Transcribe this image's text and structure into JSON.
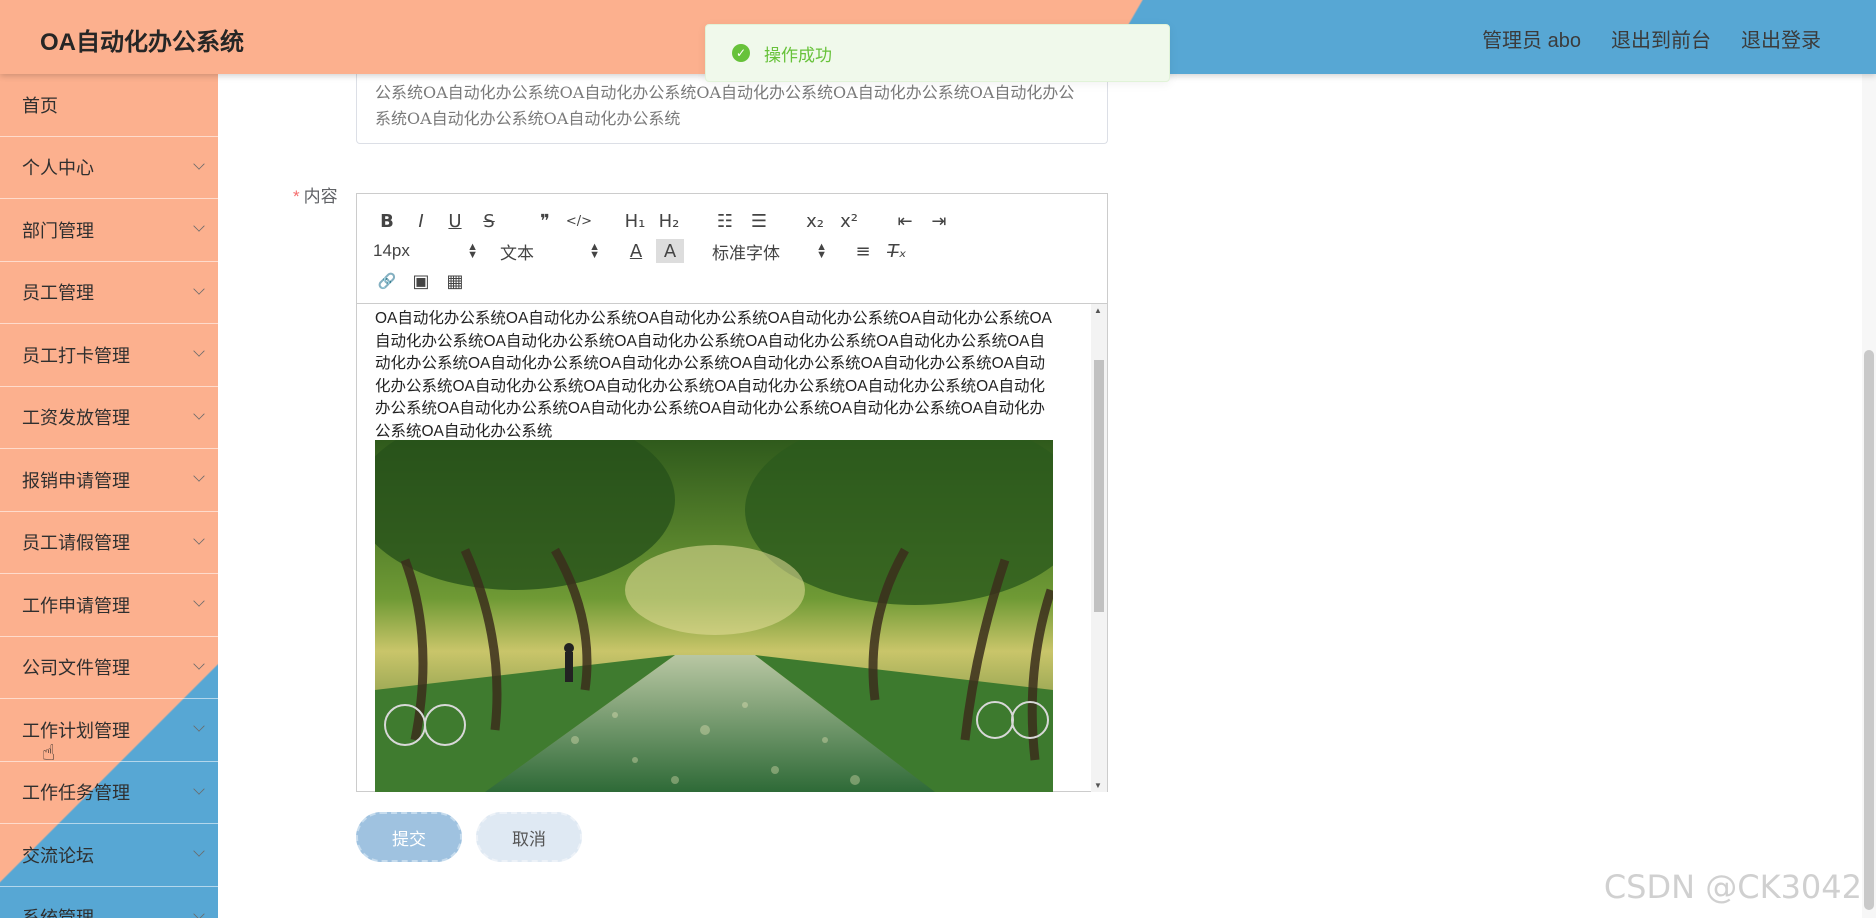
{
  "header": {
    "title": "OA自动化办公系统",
    "user": "管理员 abo",
    "to_front": "退出到前台",
    "logout": "退出登录"
  },
  "toast": {
    "message": "操作成功"
  },
  "sidebar": {
    "items": [
      {
        "label": "首页",
        "has_children": false
      },
      {
        "label": "个人中心",
        "has_children": true
      },
      {
        "label": "部门管理",
        "has_children": true
      },
      {
        "label": "员工管理",
        "has_children": true
      },
      {
        "label": "员工打卡管理",
        "has_children": true
      },
      {
        "label": "工资发放管理",
        "has_children": true
      },
      {
        "label": "报销申请管理",
        "has_children": true
      },
      {
        "label": "员工请假管理",
        "has_children": true
      },
      {
        "label": "工作申请管理",
        "has_children": true
      },
      {
        "label": "公司文件管理",
        "has_children": true
      },
      {
        "label": "工作计划管理",
        "has_children": true
      },
      {
        "label": "工作任务管理",
        "has_children": true
      },
      {
        "label": "交流论坛",
        "has_children": true
      },
      {
        "label": "系统管理",
        "has_children": true
      }
    ]
  },
  "form": {
    "summary_text": "公系统OA自动化办公系统OA自动化办公系统OA自动化办公系统OA自动化办公系统OA自动化办公系统OA自动化办公系统OA自动化办公系统",
    "content_label": "内容",
    "required_mark": "*",
    "toolbar": {
      "bold": "B",
      "italic": "I",
      "underline": "U",
      "strike": "S",
      "blockquote": "❞",
      "code": "</>",
      "h1": "H₁",
      "h2": "H₂",
      "ordered_list": "☷",
      "bullet_list": "☰",
      "subscript": "x₂",
      "superscript": "x²",
      "outdent": "⇤",
      "indent": "⇥",
      "font_size": "14px",
      "header_select": "文本",
      "font_family": "标准字体",
      "color": "A",
      "background": "A",
      "align": "≡",
      "clean": "T̶ₓ",
      "link": "🔗",
      "image": "▣",
      "video": "▦"
    },
    "editor_text": "OA自动化办公系统OA自动化办公系统OA自动化办公系统OA自动化办公系统OA自动化办公系统OA自动化办公系统OA自动化办公系统OA自动化办公系统OA自动化办公系统OA自动化办公系统OA自动化办公系统OA自动化办公系统OA自动化办公系统OA自动化办公系统OA自动化办公系统OA自动化办公系统OA自动化办公系统OA自动化办公系统OA自动化办公系统OA自动化办公系统OA自动化办公系统OA自动化办公系统OA自动化办公系统OA自动化办公系统OA自动化办公系统OA自动化办公系统OA自动化办公系统",
    "submit_label": "提交",
    "cancel_label": "取消"
  },
  "watermark": "CSDN @CK3042",
  "colors": {
    "header_peach": "#fcb08e",
    "header_blue": "#57a7d4",
    "toast_green": "#67c23a",
    "submit_blue": "#9fc2e0"
  }
}
